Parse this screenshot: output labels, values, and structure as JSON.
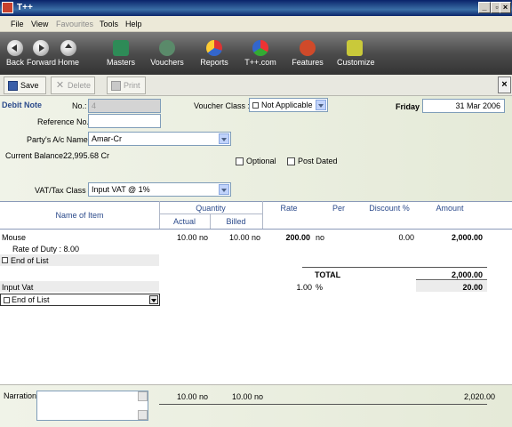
{
  "window": {
    "title": "T++",
    "min": "_",
    "max": "▫",
    "close": "×"
  },
  "menu": [
    "File",
    "View",
    "Favourites",
    "Tools",
    "Help"
  ],
  "toolbar": [
    "Back",
    "Forward",
    "Home",
    "Masters",
    "Vouchers",
    "Reports",
    "T++.com",
    "Features",
    "Customize"
  ],
  "actions": {
    "save": "Save",
    "delete": "Delete",
    "print": "Print",
    "close": "×"
  },
  "form": {
    "voucher_type": "Debit Note",
    "no_label": "No.:",
    "no_value": "4",
    "ref_label": "Reference No.:",
    "ref_value": "",
    "party_label": "Party's A/c Name :",
    "party_value": "Amar-Cr",
    "balance_label": "Current Balance :",
    "balance_value": "22,995.68 Cr",
    "vclass_label": "Voucher Class :",
    "vclass_value": "Not Applicable",
    "day": "Friday",
    "date": "31 Mar 2006",
    "optional_label": "Optional",
    "postdated_label": "Post Dated",
    "vat_label": "VAT/Tax Class :",
    "vat_value": "Input VAT @ 1%"
  },
  "table": {
    "headers": {
      "item": "Name of Item",
      "quantity": "Quantity",
      "actual": "Actual",
      "billed": "Billed",
      "rate": "Rate",
      "per": "Per",
      "discount": "Discount %",
      "amount": "Amount"
    },
    "row": {
      "item": "Mouse",
      "actual": "10.00 no",
      "billed": "10.00 no",
      "rate": "200.00",
      "per": "no",
      "discount": "0.00",
      "amount": "2,000.00"
    },
    "duty": "Rate of Duty :  8.00",
    "end1": "End of List",
    "total_label": "TOTAL",
    "total_value": "2,000.00",
    "tax_name": "Input Vat",
    "tax_rate": "1.00",
    "tax_pct": "%",
    "tax_amount": "20.00",
    "end2": "End of List"
  },
  "narration": {
    "label": "Narration",
    "value": "",
    "actual": "10.00 no",
    "billed": "10.00 no",
    "total": "2,020.00"
  }
}
